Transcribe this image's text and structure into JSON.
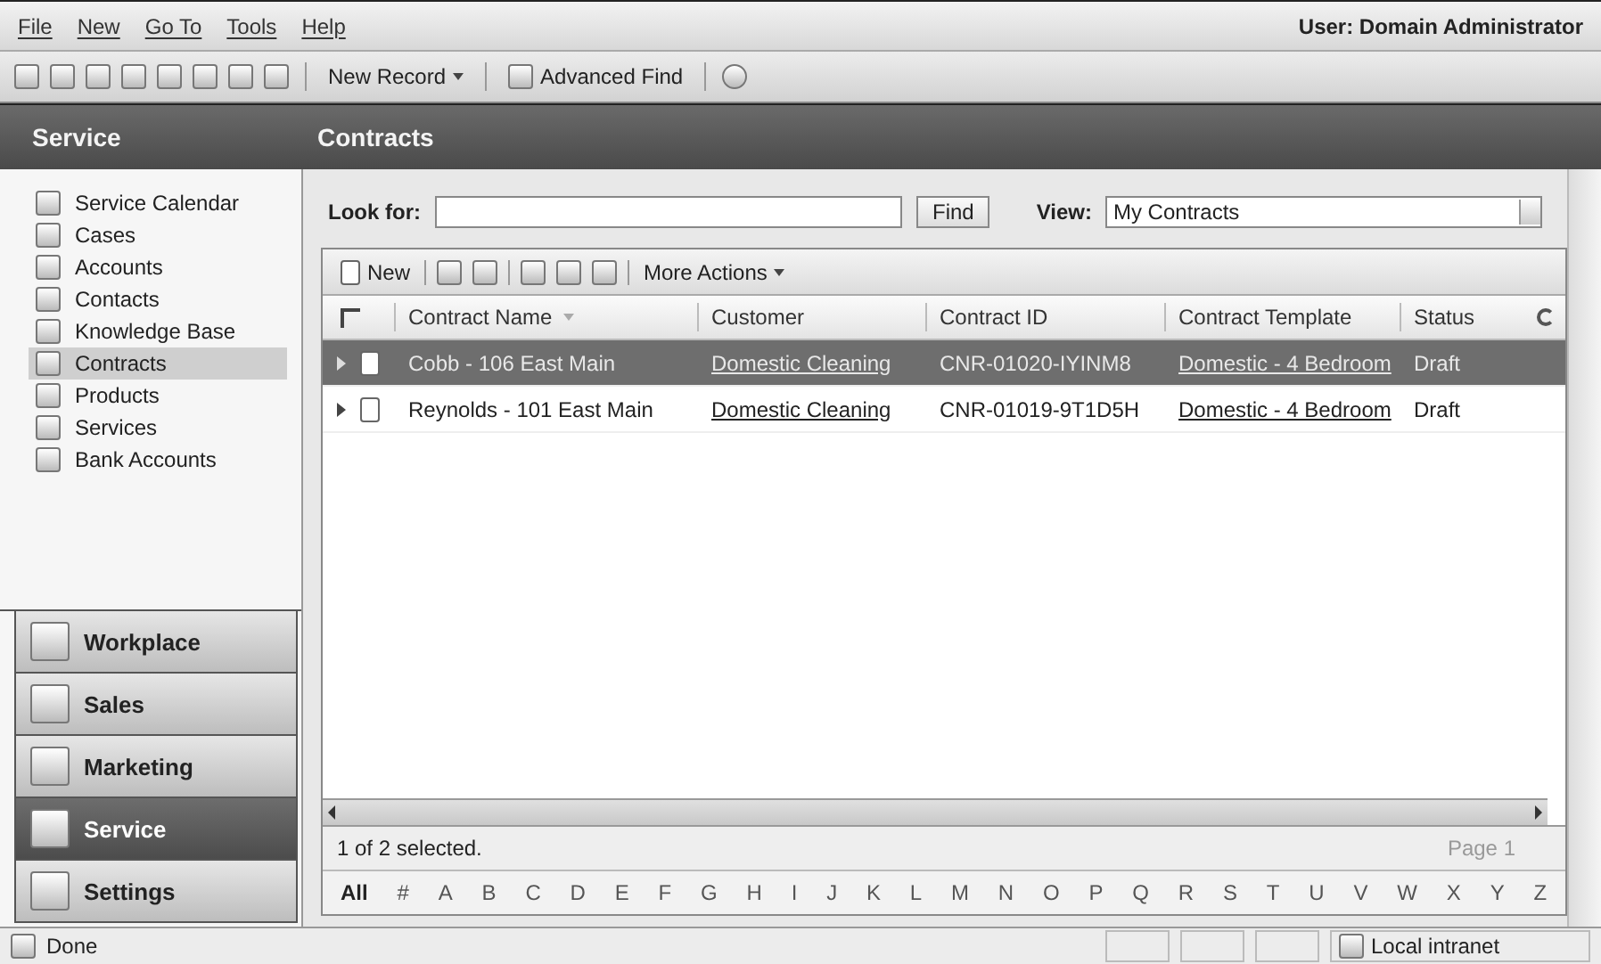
{
  "menu": [
    {
      "label": "File"
    },
    {
      "label": "New"
    },
    {
      "label": "Go To"
    },
    {
      "label": "Tools"
    },
    {
      "label": "Help"
    }
  ],
  "user": "User: Domain Administrator",
  "toolbar": [
    {
      "label": "New Record",
      "kind": "dropdown"
    },
    {
      "label": "Advanced Find",
      "kind": "button"
    }
  ],
  "sidebar": {
    "title": "Service",
    "items": [
      {
        "label": "Service Calendar",
        "selected": false
      },
      {
        "label": "Cases",
        "selected": false
      },
      {
        "label": "Accounts",
        "selected": false
      },
      {
        "label": "Contacts",
        "selected": false
      },
      {
        "label": "Knowledge Base",
        "selected": false
      },
      {
        "label": "Contracts",
        "selected": true
      },
      {
        "label": "Products",
        "selected": false
      },
      {
        "label": "Services",
        "selected": false
      },
      {
        "label": "Bank Accounts",
        "selected": false
      }
    ]
  },
  "nav_buttons": [
    {
      "label": "Workplace",
      "selected": false
    },
    {
      "label": "Sales",
      "selected": false
    },
    {
      "label": "Marketing",
      "selected": false
    },
    {
      "label": "Service",
      "selected": true
    },
    {
      "label": "Settings",
      "selected": false
    }
  ],
  "page_title": "Contracts",
  "search": {
    "label": "Look for:",
    "button": "Find"
  },
  "view": {
    "label": "View:",
    "value": "My Contracts"
  },
  "grid_toolbar": {
    "new": "New",
    "more": "More Actions"
  },
  "table": {
    "select_all_checked": false,
    "columns": [
      {
        "label": "Contract Name",
        "kind": "text",
        "sorted": true
      },
      {
        "label": "Customer",
        "kind": "link",
        "sorted": false
      },
      {
        "label": "Contract ID",
        "kind": "text",
        "sorted": false
      },
      {
        "label": "Contract Template",
        "kind": "link",
        "sorted": false
      },
      {
        "label": "Status",
        "kind": "text",
        "sorted": false
      }
    ],
    "rows": [
      {
        "selected": true,
        "cells": [
          "Cobb - 106 East Main",
          "Domestic Cleaning",
          "CNR-01020-IYINM8",
          "Domestic - 4 Bedroom",
          "Draft"
        ]
      },
      {
        "selected": false,
        "cells": [
          "Reynolds - 101 East Main",
          "Domestic Cleaning",
          "CNR-01019-9T1D5H",
          "Domestic - 4 Bedroom",
          "Draft"
        ]
      }
    ]
  },
  "record_count": "1 of 2 selected.",
  "pager": "Page 1",
  "alphabet": [
    "All",
    "#",
    "A",
    "B",
    "C",
    "D",
    "E",
    "F",
    "G",
    "H",
    "I",
    "J",
    "K",
    "L",
    "M",
    "N",
    "O",
    "P",
    "Q",
    "R",
    "S",
    "T",
    "U",
    "V",
    "W",
    "X",
    "Y",
    "Z"
  ],
  "status_bar": {
    "text": "Done",
    "zone": "Local intranet"
  }
}
